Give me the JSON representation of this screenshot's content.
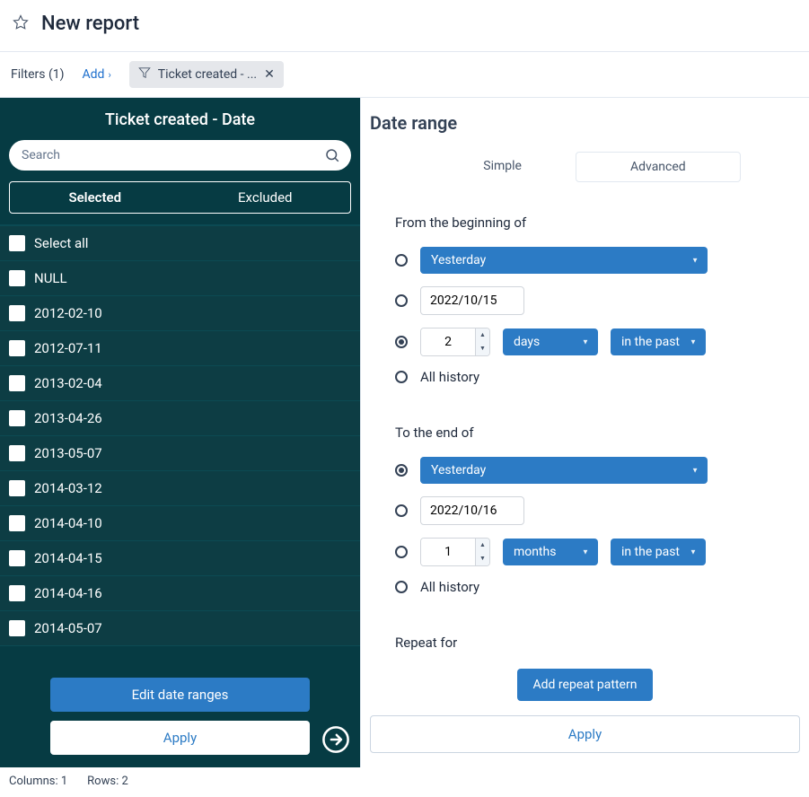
{
  "header": {
    "title": "New report"
  },
  "filter_bar": {
    "label": "Filters (1)",
    "add": "Add",
    "chip": "Ticket created - ..."
  },
  "sidebar": {
    "title": "Ticket created - Date",
    "search_placeholder": "Search",
    "tab_selected": "Selected",
    "tab_excluded": "Excluded",
    "select_all": "Select all",
    "items": [
      "NULL",
      "2012-02-10",
      "2012-07-11",
      "2013-02-04",
      "2013-04-26",
      "2013-05-07",
      "2014-03-12",
      "2014-04-10",
      "2014-04-15",
      "2014-04-16",
      "2014-05-07"
    ],
    "edit_ranges": "Edit date ranges",
    "apply": "Apply"
  },
  "main": {
    "title": "Date range",
    "simple": "Simple",
    "advanced": "Advanced",
    "from_label": "From the beginning of",
    "from_opts": {
      "yesterday": "Yesterday",
      "date": "2022/10/15",
      "num": "2",
      "unit": "days",
      "dir": "in the past",
      "all": "All history"
    },
    "to_label": "To the end of",
    "to_opts": {
      "yesterday": "Yesterday",
      "date": "2022/10/16",
      "num": "1",
      "unit": "months",
      "dir": "in the past",
      "all": "All history"
    },
    "repeat_label": "Repeat for",
    "add_pattern": "Add repeat pattern",
    "apply": "Apply"
  },
  "status": {
    "columns": "Columns: 1",
    "rows": "Rows: 2"
  }
}
